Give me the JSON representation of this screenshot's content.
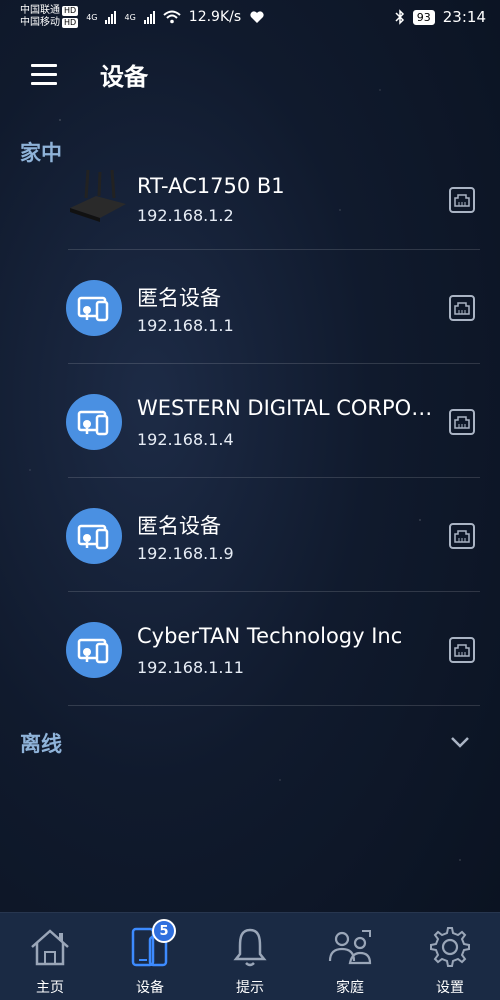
{
  "status_bar": {
    "carrier1": "中国联通",
    "carrier2": "中国移动",
    "hd": "HD",
    "net_type": "4G",
    "speed": "12.9K/s",
    "battery": "93",
    "time": "23:14"
  },
  "header": {
    "title": "设备",
    "menu_icon": "menu-icon"
  },
  "sections": {
    "home": "家中",
    "offline": "离线"
  },
  "devices": [
    {
      "name": "RT-AC1750 B1",
      "ip": "192.168.1.2",
      "icon": "router-icon"
    },
    {
      "name": "匿名设备",
      "ip": "192.168.1.1",
      "icon": "device-icon"
    },
    {
      "name": "WESTERN DIGITAL CORPORATION",
      "ip": "192.168.1.4",
      "icon": "device-icon"
    },
    {
      "name": "匿名设备",
      "ip": "192.168.1.9",
      "icon": "device-icon"
    },
    {
      "name": "CyberTAN Technology Inc",
      "ip": "192.168.1.11",
      "icon": "device-icon"
    }
  ],
  "nav": [
    {
      "label": "主页",
      "icon": "home-icon"
    },
    {
      "label": "设备",
      "icon": "devices-icon",
      "badge": "5"
    },
    {
      "label": "提示",
      "icon": "bell-icon"
    },
    {
      "label": "家庭",
      "icon": "family-icon"
    },
    {
      "label": "设置",
      "icon": "gear-icon"
    }
  ],
  "colors": {
    "accent": "#4a90e2",
    "section_title": "#8fb3d9",
    "nav_bg": "#1a2a44"
  }
}
